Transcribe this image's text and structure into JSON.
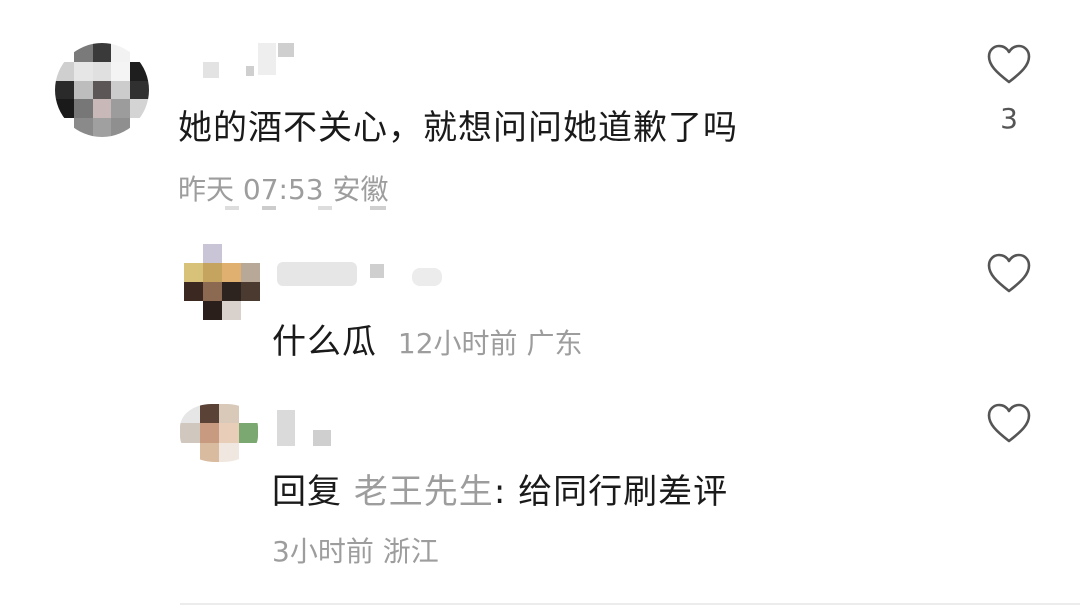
{
  "comments": [
    {
      "text": "她的酒不关心，就想问问她道歉了吗",
      "time": "昨天 07:53",
      "location": "安徽",
      "likes": "3"
    }
  ],
  "replies": [
    {
      "text": "什么瓜",
      "time": "12小时前",
      "location": "广东"
    },
    {
      "reply_prefix": "回复",
      "reply_to": "老王先生",
      "text": ": 给同行刷差评",
      "time": "3小时前",
      "location": "浙江"
    }
  ],
  "icons": {
    "like": "heart-outline-icon"
  },
  "colors": {
    "text_primary": "#1a1a1a",
    "text_secondary": "#9d9d9d"
  }
}
